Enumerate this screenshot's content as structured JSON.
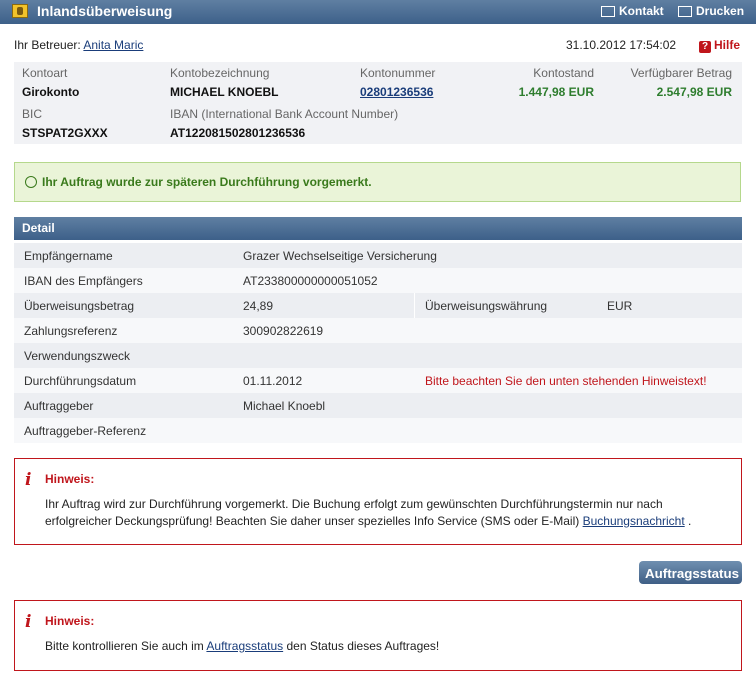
{
  "window": {
    "title": "Inlandsüberweisung",
    "kontakt": "Kontakt",
    "drucken": "Drucken"
  },
  "betreuer": {
    "label": "Ihr Betreuer:",
    "name": "Anita Maric"
  },
  "datetime": "31.10.2012 17:54:02",
  "hilfe": "Hilfe",
  "account": {
    "kontoart_label": "Kontoart",
    "kontoart": "Girokonto",
    "bez_label": "Kontobezeichnung",
    "bez": "MICHAEL KNOEBL",
    "nr_label": "Kontonummer",
    "nr": "02801236536",
    "stand_label": "Kontostand",
    "stand": "1.447,98 EUR",
    "verf_label": "Verfügbarer Betrag",
    "verf": "2.547,98 EUR",
    "bic_label": "BIC",
    "bic": "STSPAT2GXXX",
    "iban_label": "IBAN (International Bank Account Number)",
    "iban": "AT122081502801236536",
    "color_green": "#2e7d2e"
  },
  "success": "Ihr Auftrag wurde zur späteren Durchführung vorgemerkt.",
  "detail": {
    "title": "Detail",
    "empfaenger_label": "Empfängername",
    "empfaenger": "Grazer Wechselseitige Versicherung",
    "iban_label": "IBAN des Empfängers",
    "iban": "AT233800000000051052",
    "betrag_label": "Überweisungsbetrag",
    "betrag": "24,89",
    "waehrung_label": "Überweisungswährung",
    "waehrung": "EUR",
    "referenz_label": "Zahlungsreferenz",
    "referenz": "300902822619",
    "zweck_label": "Verwendungszweck",
    "datum_label": "Durchführungsdatum",
    "datum": "01.11.2012",
    "datum_hint": "Bitte beachten Sie den unten stehenden Hinweistext!",
    "auftraggeber_label": "Auftraggeber",
    "auftraggeber": "Michael Knoebl",
    "aref_label": "Auftraggeber-Referenz"
  },
  "hinweis1": {
    "title": "Hinweis:",
    "line1": "Ihr Auftrag wird zur Durchführung vorgemerkt. Die Buchung erfolgt zum gewünschten Durchführungstermin nur nach",
    "line2_pre": "erfolgreicher Deckungsprüfung! Beachten Sie daher unser spezielles Info Service (SMS oder E-Mail)",
    "line2_link": "Buchungsnachricht",
    "line2_post": "."
  },
  "button_status": "Auftragsstatus",
  "hinweis2": {
    "title": "Hinweis:",
    "pre": "Bitte kontrollieren Sie auch im",
    "link": "Auftragsstatus",
    "post": "den Status dieses Auftrages!"
  },
  "icons": {
    "title": "safe-icon",
    "kontakt": "envelope-icon",
    "drucken": "printer-icon",
    "hilfe": "help-icon",
    "success": "checkmark-icon",
    "hinweis": "info-icon"
  },
  "colors": {
    "header": "#3d6089",
    "alert": "#c0161c",
    "success_bg": "#eaf4d8"
  }
}
